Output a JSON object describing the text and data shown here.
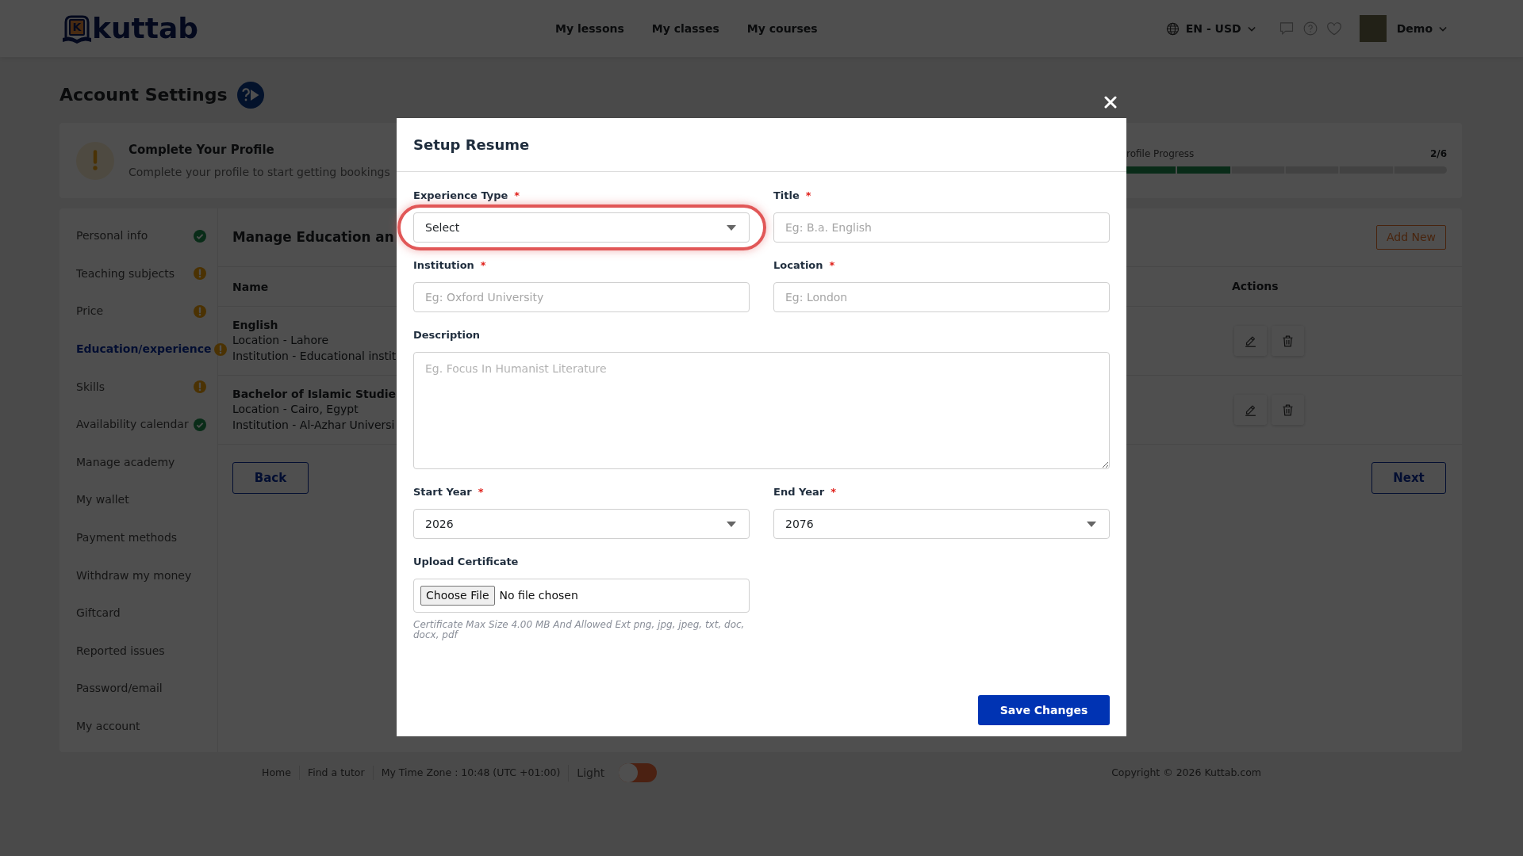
{
  "header": {
    "logo": {
      "letter": "K",
      "text": "kuttab"
    },
    "nav": [
      "My lessons",
      "My classes",
      "My courses"
    ],
    "language": "EN - USD",
    "user": "Demo"
  },
  "page_title": "Account Settings",
  "profile_card": {
    "title": "Complete Your Profile",
    "subtitle": "Complete your profile to start getting bookings",
    "progress": {
      "label": "rofile Progress",
      "count": "2/6",
      "level": 0.3333
    }
  },
  "sidebar": {
    "items": [
      {
        "label": "Personal info",
        "selected": false,
        "complete": true
      },
      {
        "label": "Teaching subjects",
        "selected": false,
        "complete": false
      },
      {
        "label": "Price",
        "selected": false,
        "complete": false
      },
      {
        "label": "Education/experience",
        "selected": true,
        "complete": false
      },
      {
        "label": "Skills",
        "selected": false,
        "complete": false
      },
      {
        "label": "Availability calendar",
        "selected": false,
        "complete": true
      },
      {
        "label": "Manage academy",
        "selected": false
      },
      {
        "label": "My wallet",
        "selected": false
      },
      {
        "label": "Payment methods",
        "selected": false
      },
      {
        "label": "Withdraw my money",
        "selected": false
      },
      {
        "label": "Giftcard",
        "selected": false
      },
      {
        "label": "Reported issues",
        "selected": false
      },
      {
        "label": "Password/email",
        "selected": false
      },
      {
        "label": "My account",
        "selected": false
      }
    ]
  },
  "content": {
    "title": "Manage Education an",
    "add_button": "Add New",
    "columns": [
      "Name",
      "Actions"
    ],
    "rows": [
      {
        "title": "English",
        "details": [
          "Location - Lahore",
          "Institution - Educational instit"
        ]
      },
      {
        "title": "Bachelor of Islamic Studie",
        "details": [
          "Location - Cairo, Egypt",
          "Institution - Al-Azhar Universi"
        ]
      }
    ],
    "back_button": "Back",
    "next_button": "Next"
  },
  "footer": {
    "links": [
      "Home",
      "Find a tutor"
    ],
    "timezone": "My Time Zone : 10:48 (UTC +01:00)",
    "theme_toggle": {
      "label": "Light",
      "on": false
    },
    "copyright": "Copyright © 2026 Kuttab.com"
  },
  "modal": {
    "title": "Setup Resume",
    "fields": [
      {
        "kind": "select",
        "label": "Experience Type",
        "required_mark": "*",
        "value": "Select",
        "highlighted": true
      },
      {
        "kind": "text",
        "label": "Title",
        "required_mark": "*",
        "placeholder": "Eg: B.a. English"
      },
      {
        "kind": "text",
        "label": "Institution",
        "required_mark": "*",
        "placeholder": "Eg: Oxford University"
      },
      {
        "kind": "text",
        "label": "Location",
        "required_mark": "*",
        "placeholder": "Eg: London"
      },
      {
        "kind": "textarea",
        "label": "Description",
        "placeholder": "Eg. Focus In Humanist Literature"
      },
      {
        "kind": "select",
        "label": "Start Year",
        "required_mark": "*",
        "value": "2026"
      },
      {
        "kind": "select",
        "label": "End Year",
        "required_mark": "*",
        "value": "2076"
      },
      {
        "kind": "file",
        "label": "Upload Certificate",
        "button": "Choose File",
        "file_status": "No file chosen",
        "hint": "Certificate Max Size 4.00 MB And Allowed Ext png, jpg, jpeg, txt, doc, docx, pdf"
      }
    ],
    "save_button": "Save Changes"
  }
}
